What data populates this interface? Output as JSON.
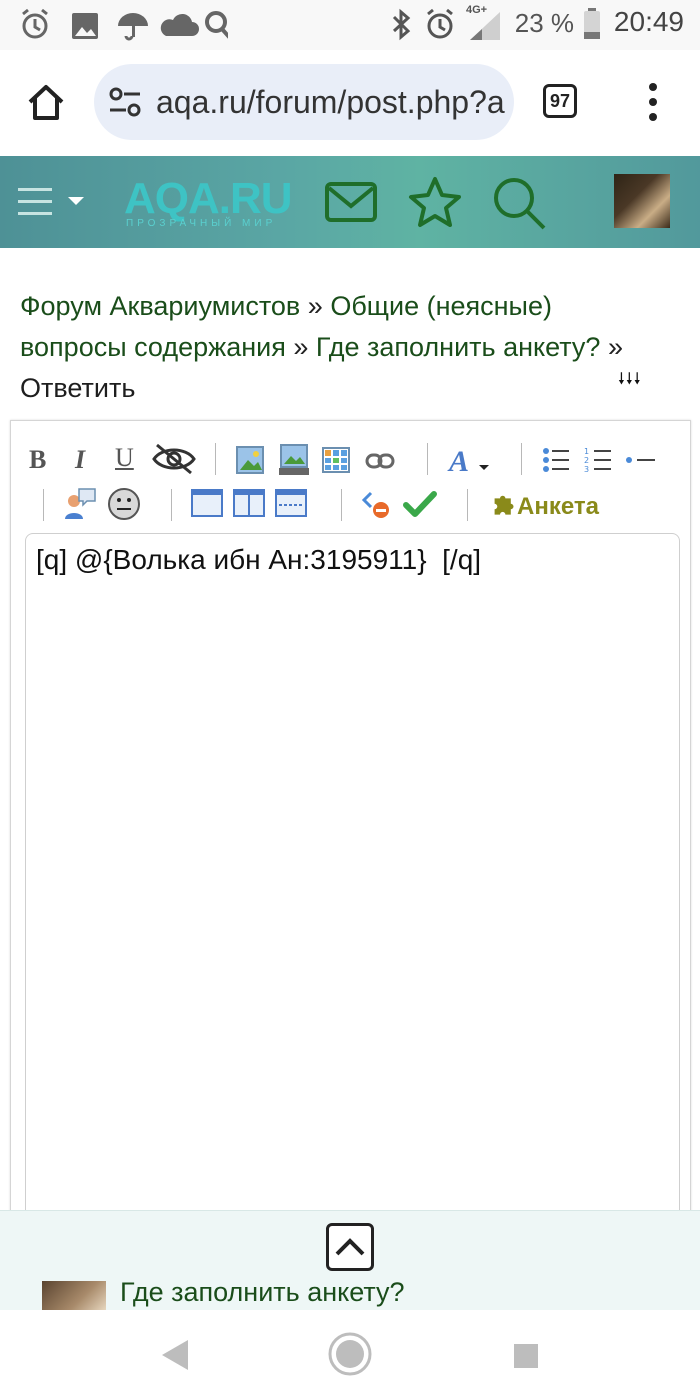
{
  "status_bar": {
    "network": "4G+",
    "battery": "23 %",
    "time": "20:49"
  },
  "browser": {
    "url": "aqa.ru/forum/post.php?a",
    "tab_count": "97"
  },
  "site": {
    "logo": "AQA.RU",
    "logo_subtitle": "ПРОЗРАЧНЫЙ МИР",
    "header_color": "#52999c",
    "icon_color": "#1f6e2a"
  },
  "breadcrumb": {
    "items": [
      {
        "label": "Форум Аквариумистов"
      },
      {
        "label": "Общие (неясные) вопросы содержания"
      },
      {
        "label": "Где заполнить анкету?"
      },
      {
        "label": "Ответить"
      }
    ],
    "separator": "»",
    "expand_glyph": "🠗🠗🠗"
  },
  "editor": {
    "toolbar": {
      "bold": "B",
      "italic": "I",
      "underline": "U",
      "anketa_label": "Анкета"
    },
    "content": "[q] @{Волька ибн Ан:3195911}  [/q]"
  },
  "bottom_panel": {
    "topic_title": "Где заполнить анкету?"
  }
}
